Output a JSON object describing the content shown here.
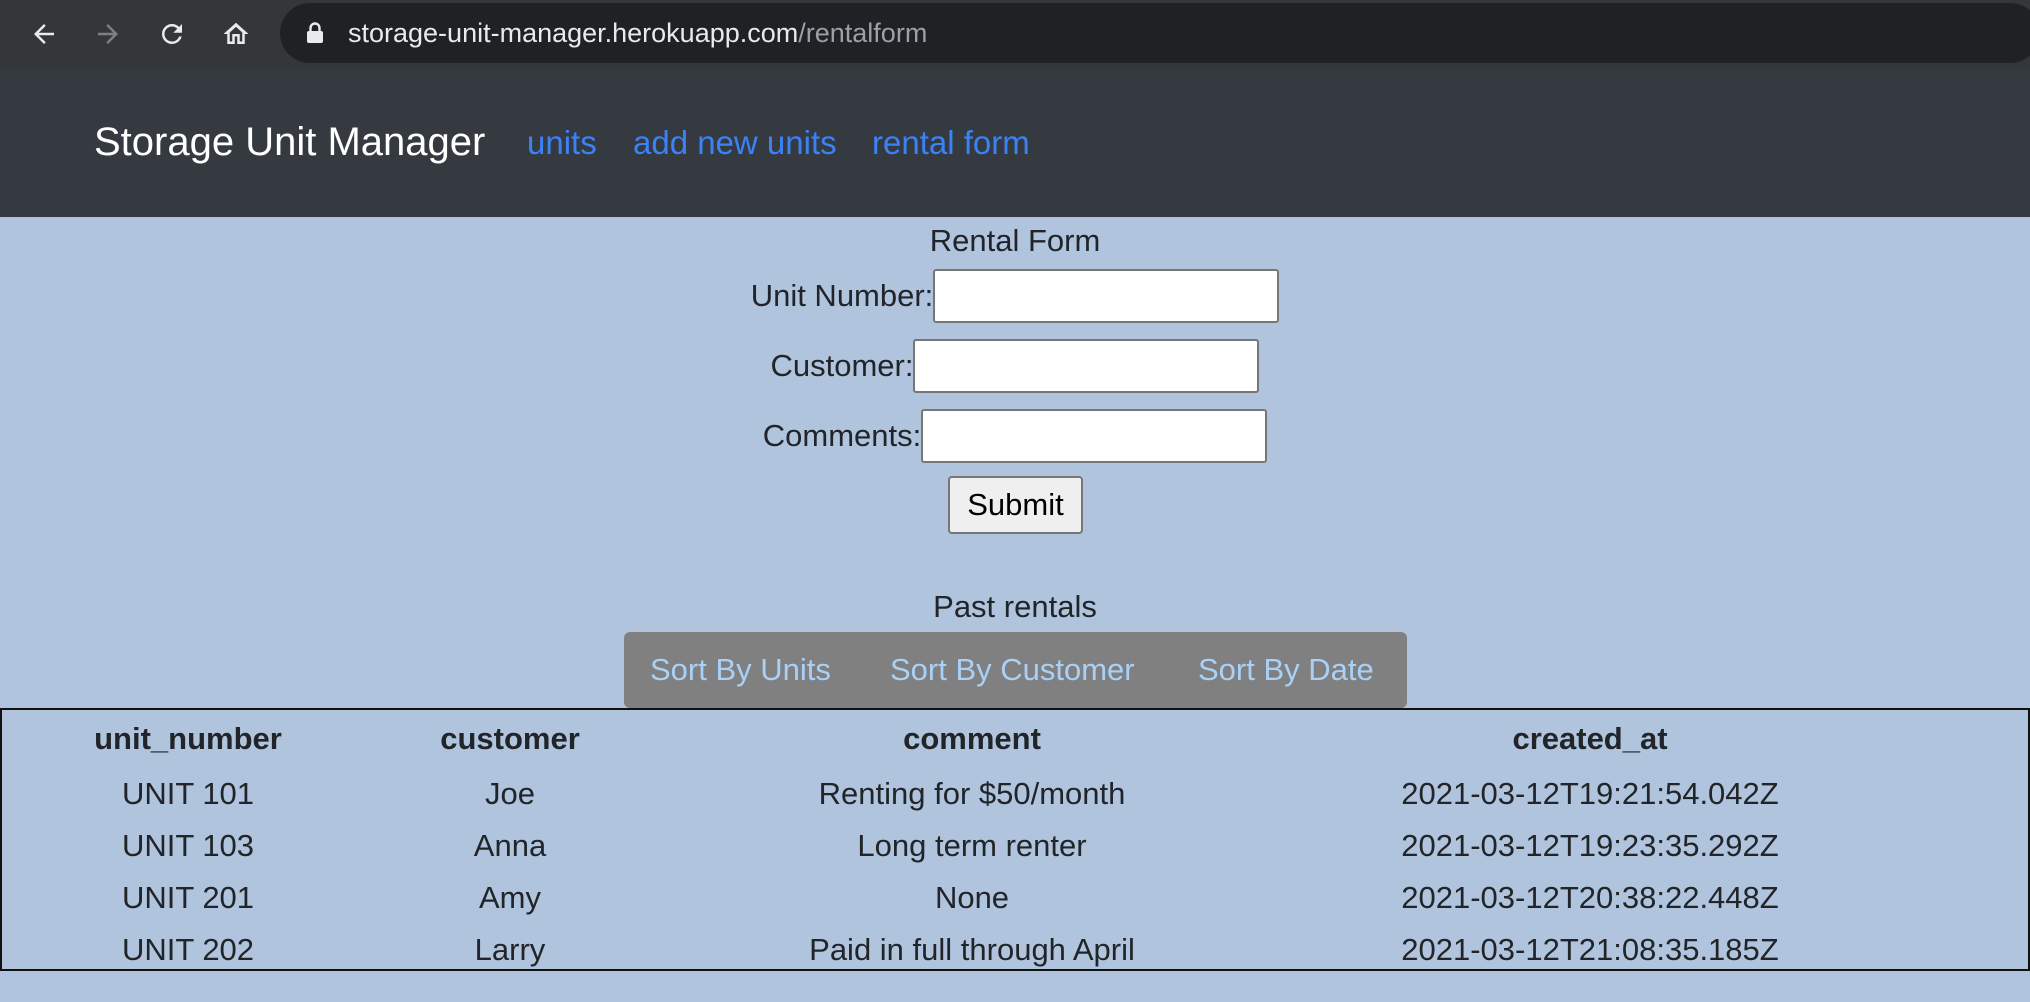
{
  "browser": {
    "url_host": "storage-unit-manager.herokuapp.com",
    "url_path": "/rentalform"
  },
  "navbar": {
    "brand": "Storage Unit Manager",
    "links": [
      "units",
      "add new units",
      "rental form"
    ],
    "link_color": "#3b82f6"
  },
  "form": {
    "title": "Rental Form",
    "unit_label": "Unit Number:",
    "unit_value": "",
    "customer_label": "Customer:",
    "customer_value": "",
    "comments_label": "Comments:",
    "comments_value": "",
    "submit_label": "Submit"
  },
  "past": {
    "title": "Past rentals",
    "sort_buttons": [
      "Sort By Units",
      "Sort By Customer",
      "Sort By Date"
    ]
  },
  "table": {
    "headers": [
      "unit_number",
      "customer",
      "comment",
      "created_at"
    ],
    "rows": [
      [
        "UNIT 101",
        "Joe",
        "Renting for $50/month",
        "2021-03-12T19:21:54.042Z"
      ],
      [
        "UNIT 103",
        "Anna",
        "Long term renter",
        "2021-03-12T19:23:35.292Z"
      ],
      [
        "UNIT 201",
        "Amy",
        "None",
        "2021-03-12T20:38:22.448Z"
      ],
      [
        "UNIT 202",
        "Larry",
        "Paid in full through April",
        "2021-03-12T21:08:35.185Z"
      ]
    ]
  },
  "colors": {
    "page_bg": "#b0c4de",
    "navbar_bg": "#343a40",
    "sort_bar_bg": "#808080",
    "sort_link": "#a9d1f7"
  }
}
